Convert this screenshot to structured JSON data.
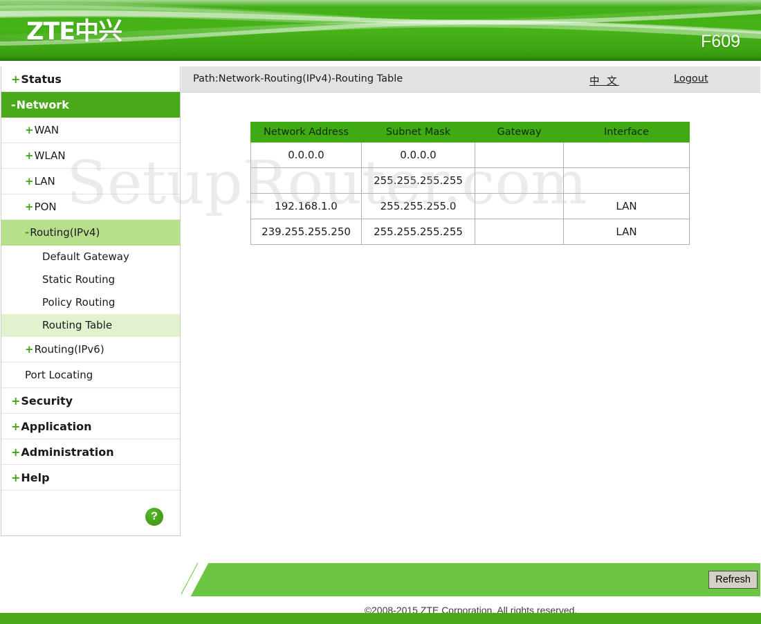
{
  "header": {
    "logo_text": "ZTE中兴",
    "model": "F609",
    "brand_green": "#46b318"
  },
  "sidebar": {
    "items": [
      {
        "label": "Status",
        "prefix": "+",
        "level": "top",
        "state": "normal"
      },
      {
        "label": "Network",
        "prefix": "-",
        "level": "top",
        "state": "active-dark"
      },
      {
        "label": "WAN",
        "prefix": "+",
        "level": "sub",
        "state": "normal"
      },
      {
        "label": "WLAN",
        "prefix": "+",
        "level": "sub",
        "state": "normal"
      },
      {
        "label": "LAN",
        "prefix": "+",
        "level": "sub",
        "state": "normal"
      },
      {
        "label": "PON",
        "prefix": "+",
        "level": "sub",
        "state": "normal"
      },
      {
        "label": "Routing(IPv4)",
        "prefix": "-",
        "level": "sub",
        "state": "active-mid"
      },
      {
        "label": "Default Gateway",
        "prefix": "",
        "level": "leaf",
        "state": "normal"
      },
      {
        "label": "Static Routing",
        "prefix": "",
        "level": "leaf",
        "state": "normal"
      },
      {
        "label": "Policy Routing",
        "prefix": "",
        "level": "leaf",
        "state": "normal"
      },
      {
        "label": "Routing Table",
        "prefix": "",
        "level": "leaf",
        "state": "active-light"
      },
      {
        "label": "Routing(IPv6)",
        "prefix": "+",
        "level": "sub",
        "state": "normal"
      },
      {
        "label": "Port Locating",
        "prefix": "",
        "level": "sub",
        "state": "normal"
      },
      {
        "label": "Security",
        "prefix": "+",
        "level": "top",
        "state": "normal"
      },
      {
        "label": "Application",
        "prefix": "+",
        "level": "top",
        "state": "normal"
      },
      {
        "label": "Administration",
        "prefix": "+",
        "level": "top",
        "state": "normal"
      },
      {
        "label": "Help",
        "prefix": "+",
        "level": "top",
        "state": "normal"
      }
    ],
    "help_icon_label": "?"
  },
  "topbar": {
    "path": "Path:Network-Routing(IPv4)-Routing Table",
    "language_link": "中 文",
    "logout_link": "Logout"
  },
  "table": {
    "columns": [
      "Network Address",
      "Subnet Mask",
      "Gateway",
      "Interface"
    ],
    "rows": [
      [
        "0.0.0.0",
        "0.0.0.0",
        "",
        ""
      ],
      [
        "",
        "255.255.255.255",
        "",
        ""
      ],
      [
        "192.168.1.0",
        "255.255.255.0",
        "",
        "LAN"
      ],
      [
        "239.255.255.250",
        "255.255.255.255",
        "",
        "LAN"
      ]
    ]
  },
  "footer": {
    "refresh_label": "Refresh",
    "copyright": "©2008-2015 ZTE Corporation. All rights reserved."
  },
  "watermark": {
    "text": "SetupRouter.com"
  }
}
